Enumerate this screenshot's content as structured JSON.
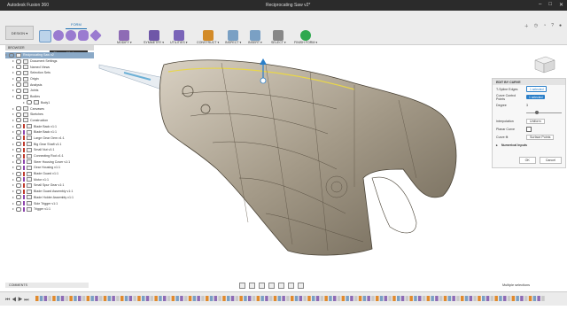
{
  "titlebar": {
    "app": "Autodesk Fusion 360",
    "document": "Reciprocating Saw v2*"
  },
  "ribbon": {
    "workspace": "DESIGN ▾",
    "active_tab": "FORM",
    "groups": [
      {
        "label": "MODIFY ▾",
        "color": "#8e6bb5"
      },
      {
        "label": "SYMMETRY ▾",
        "color": "#6f57a8"
      },
      {
        "label": "UTILITIES ▾",
        "color": "#7a64b8"
      },
      {
        "label": "CONSTRUCT ▾",
        "color": "#d38b28"
      },
      {
        "label": "INSPECT ▾",
        "color": "#7aa0c4"
      },
      {
        "label": "INSERT ▾",
        "color": "#7aa0c4"
      },
      {
        "label": "SELECT ▾",
        "color": "#888888"
      },
      {
        "label": "FINISH FORM ▾",
        "color": "#2fa84f"
      }
    ],
    "tooltip": "Change Workspace"
  },
  "browser": {
    "header": "BROWSER",
    "items": [
      {
        "label": "Reciprocating Saw v2",
        "kind": "root",
        "selected": true
      },
      {
        "label": "Document Settings",
        "kind": "folder"
      },
      {
        "label": "Named Views",
        "kind": "folder"
      },
      {
        "label": "Selection Sets",
        "kind": "folder"
      },
      {
        "label": "Origin",
        "kind": "folder"
      },
      {
        "label": "Analysis",
        "kind": "folder"
      },
      {
        "label": "Joints",
        "kind": "folder"
      },
      {
        "label": "Bodies",
        "kind": "folder"
      },
      {
        "label": "Body1",
        "kind": "body"
      },
      {
        "label": "Canvases",
        "kind": "folder"
      },
      {
        "label": "Sketches",
        "kind": "folder"
      },
      {
        "label": "Construction",
        "kind": "folder"
      },
      {
        "label": "Blade Back v1:1",
        "kind": "component",
        "color": "#c0392b"
      },
      {
        "label": "Blade Back v1:1",
        "kind": "component",
        "color": "#8e44ad"
      },
      {
        "label": "Large Gear Oem v1:1",
        "kind": "component",
        "color": "#c0392b"
      },
      {
        "label": "Big Gear Shaft v1:1",
        "kind": "component",
        "color": "#c0392b"
      },
      {
        "label": "Small Nut v1:1",
        "kind": "component",
        "color": "#c0392b"
      },
      {
        "label": "Connecting Rod v1:1",
        "kind": "component",
        "color": "#c0392b"
      },
      {
        "label": "Steer Housing Cover v1:1",
        "kind": "component",
        "color": "#8e44ad"
      },
      {
        "label": "Gear Housing v1:1",
        "kind": "component",
        "color": "#8e44ad"
      },
      {
        "label": "Blade Guard v1:1",
        "kind": "component",
        "color": "#c0392b"
      },
      {
        "label": "Motor v1:1",
        "kind": "component",
        "color": "#8e44ad"
      },
      {
        "label": "Small Spur Gear v1:1",
        "kind": "component",
        "color": "#c0392b"
      },
      {
        "label": "Blade Guard Assembly v1:1",
        "kind": "component",
        "color": "#c0392b"
      },
      {
        "label": "Blade Holder Assembly v1:1",
        "kind": "component",
        "color": "#8e44ad"
      },
      {
        "label": "Side Trigger v1:1",
        "kind": "component",
        "color": "#8e44ad"
      },
      {
        "label": "Trigger v1:1",
        "kind": "component",
        "color": "#8e44ad"
      }
    ]
  },
  "panel": {
    "title": "EDIT BY CURVE",
    "rows": [
      {
        "label": "T-Spline Edges",
        "value": "1 selected",
        "style": "sel-white"
      },
      {
        "label": "Curve Control Points",
        "value": "1 selected",
        "style": "sel-blue"
      },
      {
        "label": "Degree",
        "value": "3",
        "style": "text"
      },
      {
        "label": "",
        "value": "",
        "style": "slider"
      },
      {
        "label": "Interpolation",
        "value": "Uniform",
        "style": "dropdown"
      },
      {
        "label": "Planar Curve",
        "value": "",
        "style": "checkbox"
      },
      {
        "label": "Curve fit",
        "value": "Surface Points",
        "style": "dropdown"
      }
    ],
    "section": "Numerical Inputs",
    "ok": "OK",
    "cancel": "Cancel"
  },
  "status": {
    "comments": "COMMENTS",
    "multi": "Multiple selections"
  }
}
